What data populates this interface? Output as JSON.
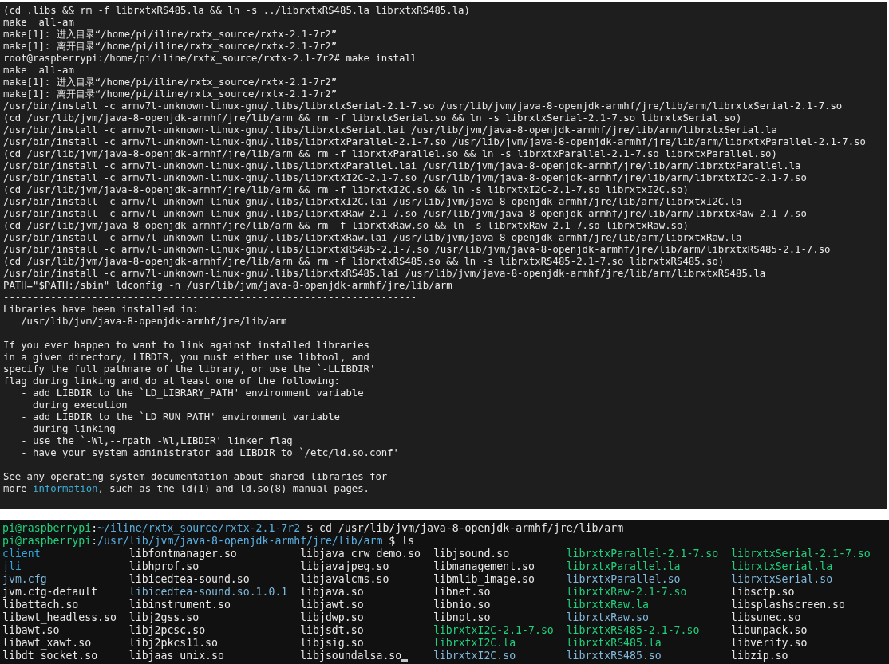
{
  "install_terminal": {
    "blocks": [
      [
        {
          "text": "(cd .libs && rm -f librxtxRS485.la && ln -s ../librxtxRS485.la librxtxRS485.la)"
        },
        {
          "text": "make  all-am"
        },
        {
          "text": "make[1]: 进入目录“/home/pi/iline/rxtx_source/rxtx-2.1-7r2”"
        },
        {
          "text": "make[1]: 离开目录“/home/pi/iline/rxtx_source/rxtx-2.1-7r2”"
        },
        {
          "text": "root@raspberrypi:/home/pi/iline/rxtx_source/rxtx-2.1-7r2# make install"
        },
        {
          "text": "make  all-am"
        },
        {
          "text": "make[1]: 进入目录“/home/pi/iline/rxtx_source/rxtx-2.1-7r2”"
        },
        {
          "text": "make[1]: 离开目录“/home/pi/iline/rxtx_source/rxtx-2.1-7r2”"
        },
        {
          "text": "/usr/bin/install -c armv7l-unknown-linux-gnu/.libs/librxtxSerial-2.1-7.so /usr/lib/jvm/java-8-openjdk-armhf/jre/lib/arm/librxtxSerial-2.1-7.so"
        },
        {
          "text": "(cd /usr/lib/jvm/java-8-openjdk-armhf/jre/lib/arm && rm -f librxtxSerial.so && ln -s librxtxSerial-2.1-7.so librxtxSerial.so)"
        },
        {
          "text": "/usr/bin/install -c armv7l-unknown-linux-gnu/.libs/librxtxSerial.lai /usr/lib/jvm/java-8-openjdk-armhf/jre/lib/arm/librxtxSerial.la"
        },
        {
          "text": "/usr/bin/install -c armv7l-unknown-linux-gnu/.libs/librxtxParallel-2.1-7.so /usr/lib/jvm/java-8-openjdk-armhf/jre/lib/arm/librxtxParallel-2.1-7.so"
        },
        {
          "text": "(cd /usr/lib/jvm/java-8-openjdk-armhf/jre/lib/arm && rm -f librxtxParallel.so && ln -s librxtxParallel-2.1-7.so librxtxParallel.so)"
        },
        {
          "text": "/usr/bin/install -c armv7l-unknown-linux-gnu/.libs/librxtxParallel.lai /usr/lib/jvm/java-8-openjdk-armhf/jre/lib/arm/librxtxParallel.la"
        },
        {
          "text": "/usr/bin/install -c armv7l-unknown-linux-gnu/.libs/librxtxI2C-2.1-7.so /usr/lib/jvm/java-8-openjdk-armhf/jre/lib/arm/librxtxI2C-2.1-7.so"
        },
        {
          "text": "(cd /usr/lib/jvm/java-8-openjdk-armhf/jre/lib/arm && rm -f librxtxI2C.so && ln -s librxtxI2C-2.1-7.so librxtxI2C.so)"
        },
        {
          "text": "/usr/bin/install -c armv7l-unknown-linux-gnu/.libs/librxtxI2C.lai /usr/lib/jvm/java-8-openjdk-armhf/jre/lib/arm/librxtxI2C.la"
        },
        {
          "text": "/usr/bin/install -c armv7l-unknown-linux-gnu/.libs/librxtxRaw-2.1-7.so /usr/lib/jvm/java-8-openjdk-armhf/jre/lib/arm/librxtxRaw-2.1-7.so"
        },
        {
          "text": "(cd /usr/lib/jvm/java-8-openjdk-armhf/jre/lib/arm && rm -f librxtxRaw.so && ln -s librxtxRaw-2.1-7.so librxtxRaw.so)"
        },
        {
          "text": "/usr/bin/install -c armv7l-unknown-linux-gnu/.libs/librxtxRaw.lai /usr/lib/jvm/java-8-openjdk-armhf/jre/lib/arm/librxtxRaw.la"
        },
        {
          "text": "/usr/bin/install -c armv7l-unknown-linux-gnu/.libs/librxtxRS485-2.1-7.so /usr/lib/jvm/java-8-openjdk-armhf/jre/lib/arm/librxtxRS485-2.1-7.so"
        },
        {
          "text": "(cd /usr/lib/jvm/java-8-openjdk-armhf/jre/lib/arm && rm -f librxtxRS485.so && ln -s librxtxRS485-2.1-7.so librxtxRS485.so)"
        },
        {
          "text": "/usr/bin/install -c armv7l-unknown-linux-gnu/.libs/librxtxRS485.lai /usr/lib/jvm/java-8-openjdk-armhf/jre/lib/arm/librxtxRS485.la"
        },
        {
          "text": "PATH=\"$PATH:/sbin\" ldconfig -n /usr/lib/jvm/java-8-openjdk-armhf/jre/lib/arm"
        },
        {
          "text": "----------------------------------------------------------------------"
        },
        {
          "text": "Libraries have been installed in:"
        },
        {
          "text": "   /usr/lib/jvm/java-8-openjdk-armhf/jre/lib/arm"
        }
      ],
      [
        {
          "text": "If you ever happen to want to link against installed libraries"
        },
        {
          "text": "in a given directory, LIBDIR, you must either use libtool, and"
        },
        {
          "text": "specify the full pathname of the library, or use the `-LLIBDIR'"
        },
        {
          "text": "flag during linking and do at least one of the following:"
        },
        {
          "text": "   - add LIBDIR to the `LD_LIBRARY_PATH' environment variable"
        },
        {
          "text": "     during execution"
        },
        {
          "text": "   - add LIBDIR to the `LD_RUN_PATH' environment variable"
        },
        {
          "text": "     during linking"
        },
        {
          "text": "   - use the `-Wl,--rpath -Wl,LIBDIR' linker flag"
        },
        {
          "text": "   - have your system administrator add LIBDIR to `/etc/ld.so.conf'"
        }
      ],
      [
        {
          "text": "See any operating system documentation about shared libraries for"
        },
        {
          "segments": [
            {
              "text": "more ",
              "highlight": false
            },
            {
              "text": "information",
              "highlight": true
            },
            {
              "text": ", such as the ld(1) and ld.so(8) manual pages.",
              "highlight": false
            }
          ]
        },
        {
          "text": "----------------------------------------------------------------------"
        }
      ]
    ]
  },
  "ls_terminal": {
    "prompts": [
      {
        "segments": [
          {
            "text": "pi@raspberrypi",
            "kind": "user"
          },
          {
            "text": ":",
            "kind": "plain"
          },
          {
            "text": "~/iline/rxtx_source/rxtx-2.1-7r2",
            "kind": "path"
          },
          {
            "text": " $ cd /usr/lib/jvm/java-8-openjdk-armhf/jre/lib/arm",
            "kind": "plain"
          }
        ]
      },
      {
        "segments": [
          {
            "text": "pi@raspberrypi",
            "kind": "user"
          },
          {
            "text": ":",
            "kind": "plain"
          },
          {
            "text": "/usr/lib/jvm/java-8-openjdk-armhf/jre/lib/arm",
            "kind": "path"
          },
          {
            "text": " $ ls",
            "kind": "plain"
          }
        ]
      }
    ],
    "listing": [
      [
        {
          "name": "client",
          "kind": "dir"
        },
        {
          "name": "jli",
          "kind": "dir"
        },
        {
          "name": "jvm.cfg",
          "kind": "link"
        },
        {
          "name": "jvm.cfg-default",
          "kind": "file"
        },
        {
          "name": "libattach.so",
          "kind": "file"
        },
        {
          "name": "libawt_headless.so",
          "kind": "file"
        },
        {
          "name": "libawt.so",
          "kind": "file"
        },
        {
          "name": "libawt_xawt.so",
          "kind": "file"
        },
        {
          "name": "libdt_socket.so",
          "kind": "file"
        }
      ],
      [
        {
          "name": "libfontmanager.so",
          "kind": "file"
        },
        {
          "name": "libhprof.so",
          "kind": "file"
        },
        {
          "name": "libicedtea-sound.so",
          "kind": "file"
        },
        {
          "name": "libicedtea-sound.so.1.0.1",
          "kind": "link"
        },
        {
          "name": "libinstrument.so",
          "kind": "file"
        },
        {
          "name": "libj2gss.so",
          "kind": "file"
        },
        {
          "name": "libj2pcsc.so",
          "kind": "file"
        },
        {
          "name": "libj2pkcs11.so",
          "kind": "file"
        },
        {
          "name": "libjaas_unix.so",
          "kind": "file"
        }
      ],
      [
        {
          "name": "libjava_crw_demo.so",
          "kind": "file"
        },
        {
          "name": "libjavajpeg.so",
          "kind": "file"
        },
        {
          "name": "libjavalcms.so",
          "kind": "file"
        },
        {
          "name": "libjava.so",
          "kind": "file"
        },
        {
          "name": "libjawt.so",
          "kind": "file"
        },
        {
          "name": "libjdwp.so",
          "kind": "file"
        },
        {
          "name": "libjsdt.so",
          "kind": "file"
        },
        {
          "name": "libjsig.so",
          "kind": "file"
        },
        {
          "name": "libjsoundalsa.so",
          "kind": "file"
        }
      ],
      [
        {
          "name": "libjsound.so",
          "kind": "file"
        },
        {
          "name": "libmanagement.so",
          "kind": "file"
        },
        {
          "name": "libmlib_image.so",
          "kind": "file"
        },
        {
          "name": "libnet.so",
          "kind": "file"
        },
        {
          "name": "libnio.so",
          "kind": "file"
        },
        {
          "name": "libnpt.so",
          "kind": "file"
        },
        {
          "name": "librxtxI2C-2.1-7.so",
          "kind": "exec"
        },
        {
          "name": "librxtxI2C.la",
          "kind": "exec"
        },
        {
          "name": "librxtxI2C.so",
          "kind": "link"
        }
      ],
      [
        {
          "name": "librxtxParallel-2.1-7.so",
          "kind": "exec"
        },
        {
          "name": "librxtxParallel.la",
          "kind": "exec"
        },
        {
          "name": "librxtxParallel.so",
          "kind": "link"
        },
        {
          "name": "librxtxRaw-2.1-7.so",
          "kind": "exec"
        },
        {
          "name": "librxtxRaw.la",
          "kind": "exec"
        },
        {
          "name": "librxtxRaw.so",
          "kind": "link"
        },
        {
          "name": "librxtxRS485-2.1-7.so",
          "kind": "exec"
        },
        {
          "name": "librxtxRS485.la",
          "kind": "exec"
        },
        {
          "name": "librxtxRS485.so",
          "kind": "link"
        }
      ],
      [
        {
          "name": "librxtxSerial-2.1-7.so",
          "kind": "exec"
        },
        {
          "name": "librxtxSerial.la",
          "kind": "exec"
        },
        {
          "name": "librxtxSerial.so",
          "kind": "link"
        },
        {
          "name": "libsctp.so",
          "kind": "file"
        },
        {
          "name": "libsplashscreen.so",
          "kind": "file"
        },
        {
          "name": "libsunec.so",
          "kind": "file"
        },
        {
          "name": "libunpack.so",
          "kind": "file"
        },
        {
          "name": "libverify.so",
          "kind": "file"
        },
        {
          "name": "libzip.so",
          "kind": "file"
        }
      ]
    ]
  }
}
